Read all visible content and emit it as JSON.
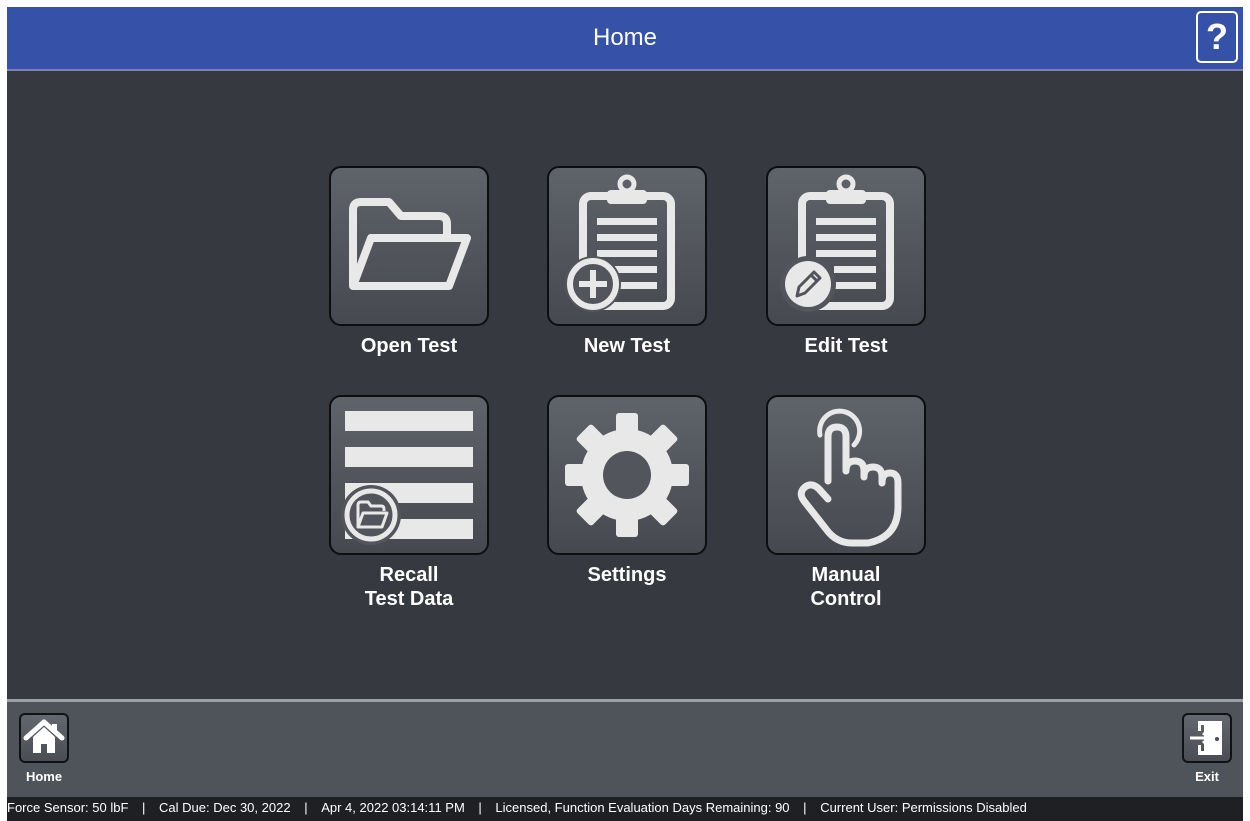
{
  "header": {
    "title": "Home",
    "help_label": "?"
  },
  "tiles": [
    {
      "label": "Open Test",
      "icon": "folder-open-icon"
    },
    {
      "label": "New Test",
      "icon": "clipboard-add-icon"
    },
    {
      "label": "Edit Test",
      "icon": "clipboard-edit-icon"
    },
    {
      "label": "Recall\nTest Data",
      "icon": "list-folder-icon"
    },
    {
      "label": "Settings",
      "icon": "gear-icon"
    },
    {
      "label": "Manual\nControl",
      "icon": "hand-pointer-icon"
    }
  ],
  "bottom": {
    "home_label": "Home",
    "exit_label": "Exit"
  },
  "status": {
    "force_sensor": "Force Sensor: 50 lbF",
    "cal_due": "Cal Due: Dec 30, 2022",
    "datetime": "Apr 4, 2022 03:14:11 PM",
    "license": "Licensed, Function Evaluation Days Remaining: 90",
    "user": "Current User: Permissions Disabled",
    "separator": "|"
  },
  "colors": {
    "header_bg": "#3652a8",
    "main_bg": "#363a40",
    "icon_fill": "#e8e8e8"
  }
}
